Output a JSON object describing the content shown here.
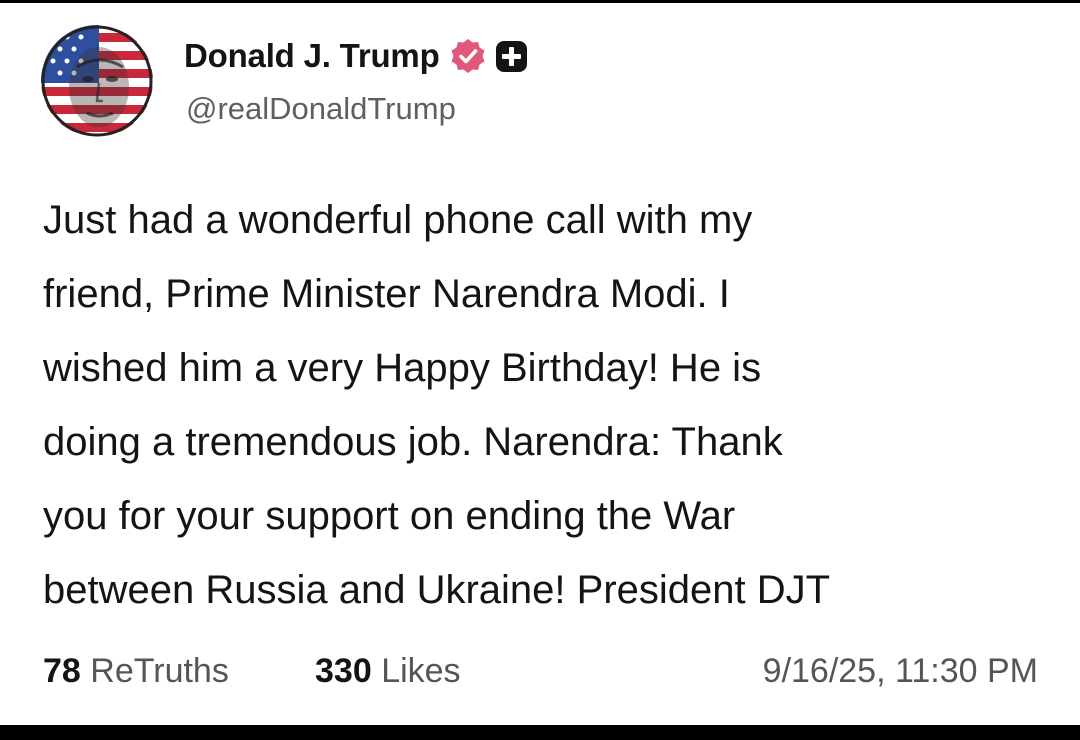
{
  "author": {
    "display_name": "Donald J. Trump",
    "handle": "@realDonaldTrump",
    "avatar_icon": "flag-face-avatar",
    "verified_icon": "verified-badge-icon",
    "verified_color": "#e0577c",
    "plus_icon": "plus-badge-icon"
  },
  "post": {
    "lines": [
      "Just had a wonderful phone call with my",
      "friend, Prime Minister Narendra Modi. I",
      "wished him a very Happy Birthday! He is",
      "doing a tremendous job. Narendra: Thank",
      "you for your support on ending the War",
      "between Russia and Ukraine! President DJT"
    ]
  },
  "stats": {
    "retruths_count": "78",
    "retruths_label": "ReTruths",
    "likes_count": "330",
    "likes_label": "Likes",
    "timestamp": "9/16/25, 11:30 PM"
  }
}
